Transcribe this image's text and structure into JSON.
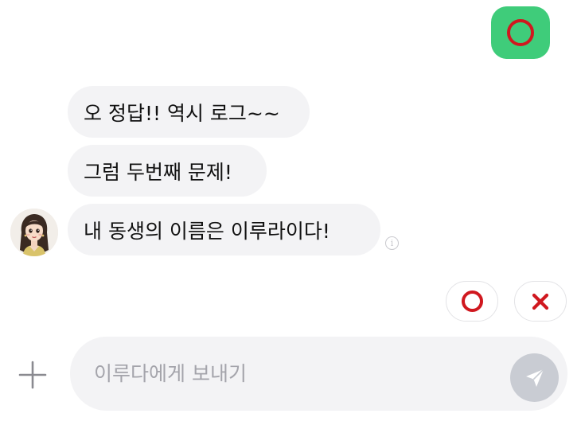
{
  "chat": {
    "sent_message": {
      "content": "O",
      "bubble_color": "#3fcc7a",
      "mark_color": "#d0181f"
    },
    "received_messages": [
      {
        "text": "오 정답!! 역시 로그~~"
      },
      {
        "text": "그럼 두번째 문제!"
      },
      {
        "text": "내 동생의 이름은 이루라이다!"
      }
    ],
    "info_icon": "info-circle-icon"
  },
  "quick_replies": [
    {
      "label": "O",
      "icon": "circle-o-icon",
      "color": "#d0181f"
    },
    {
      "label": "X",
      "icon": "cross-x-icon",
      "color": "#d0181f"
    }
  ],
  "composer": {
    "add_icon": "plus-icon",
    "placeholder": "이루다에게 보내기",
    "value": "",
    "send_icon": "paper-plane-send-icon",
    "send_button_color": "#c9ccd3"
  },
  "colors": {
    "received_bubble": "#f3f3f5",
    "input_background": "#f3f3f5",
    "text": "#111111"
  }
}
